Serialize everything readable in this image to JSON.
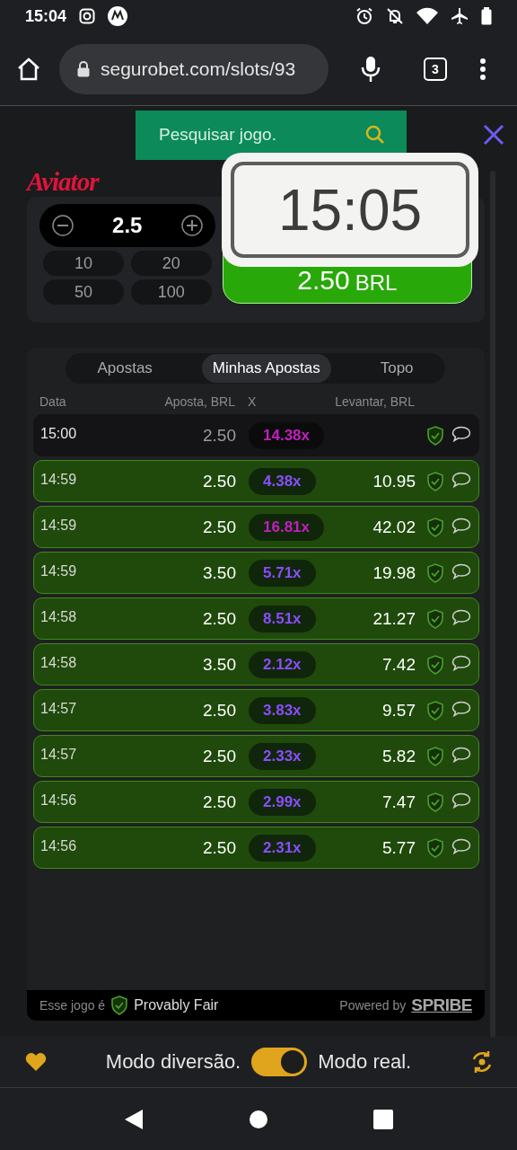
{
  "status_bar": {
    "time": "15:04"
  },
  "browser": {
    "url": "segurobet.com/slots/93",
    "tab_count": "3"
  },
  "search": {
    "placeholder": "Pesquisar jogo."
  },
  "game": {
    "logo": "Aviator",
    "bet_panel": {
      "amount": "2.5",
      "quick_amounts": [
        "10",
        "20",
        "50",
        "100"
      ],
      "bet_button": {
        "amount": "2.50",
        "currency": "BRL"
      }
    },
    "clock_overlay": "15:05",
    "tabs": [
      {
        "label": "Apostas",
        "selected": false
      },
      {
        "label": "Minhas Apostas",
        "selected": true
      },
      {
        "label": "Topo",
        "selected": false
      }
    ],
    "table": {
      "columns": [
        "Data",
        "Aposta, BRL",
        "X",
        "Levantar, BRL"
      ],
      "rows": [
        {
          "time": "15:00",
          "bet": "2.50",
          "multiplier": "14.38x",
          "color": "#c21fbf",
          "cashed_out": false
        },
        {
          "time": "14:59",
          "bet": "2.50",
          "multiplier": "4.38x",
          "color": "#8a4dff",
          "cashed_out": true,
          "payout": "10.95"
        },
        {
          "time": "14:59",
          "bet": "2.50",
          "multiplier": "16.81x",
          "color": "#c21fbf",
          "cashed_out": true,
          "payout": "42.02"
        },
        {
          "time": "14:59",
          "bet": "3.50",
          "multiplier": "5.71x",
          "color": "#8a4dff",
          "cashed_out": true,
          "payout": "19.98"
        },
        {
          "time": "14:58",
          "bet": "2.50",
          "multiplier": "8.51x",
          "color": "#8a4dff",
          "cashed_out": true,
          "payout": "21.27"
        },
        {
          "time": "14:58",
          "bet": "3.50",
          "multiplier": "2.12x",
          "color": "#8a4dff",
          "cashed_out": true,
          "payout": "7.42"
        },
        {
          "time": "14:57",
          "bet": "2.50",
          "multiplier": "3.83x",
          "color": "#8a4dff",
          "cashed_out": true,
          "payout": "9.57"
        },
        {
          "time": "14:57",
          "bet": "2.50",
          "multiplier": "2.33x",
          "color": "#8a4dff",
          "cashed_out": true,
          "payout": "5.82"
        },
        {
          "time": "14:56",
          "bet": "2.50",
          "multiplier": "2.99x",
          "color": "#8a4dff",
          "cashed_out": true,
          "payout": "7.47"
        },
        {
          "time": "14:56",
          "bet": "2.50",
          "multiplier": "2.31x",
          "color": "#8a4dff",
          "cashed_out": true,
          "payout": "5.77"
        }
      ]
    },
    "footer": {
      "fair_prefix": "Esse jogo é",
      "fair_label": "Provably Fair",
      "powered_by": "Powered by",
      "brand": "SPRIBE"
    }
  },
  "mode_bar": {
    "left_label": "Modo diversão.",
    "right_label": "Modo real.",
    "real_mode_on": true
  }
}
